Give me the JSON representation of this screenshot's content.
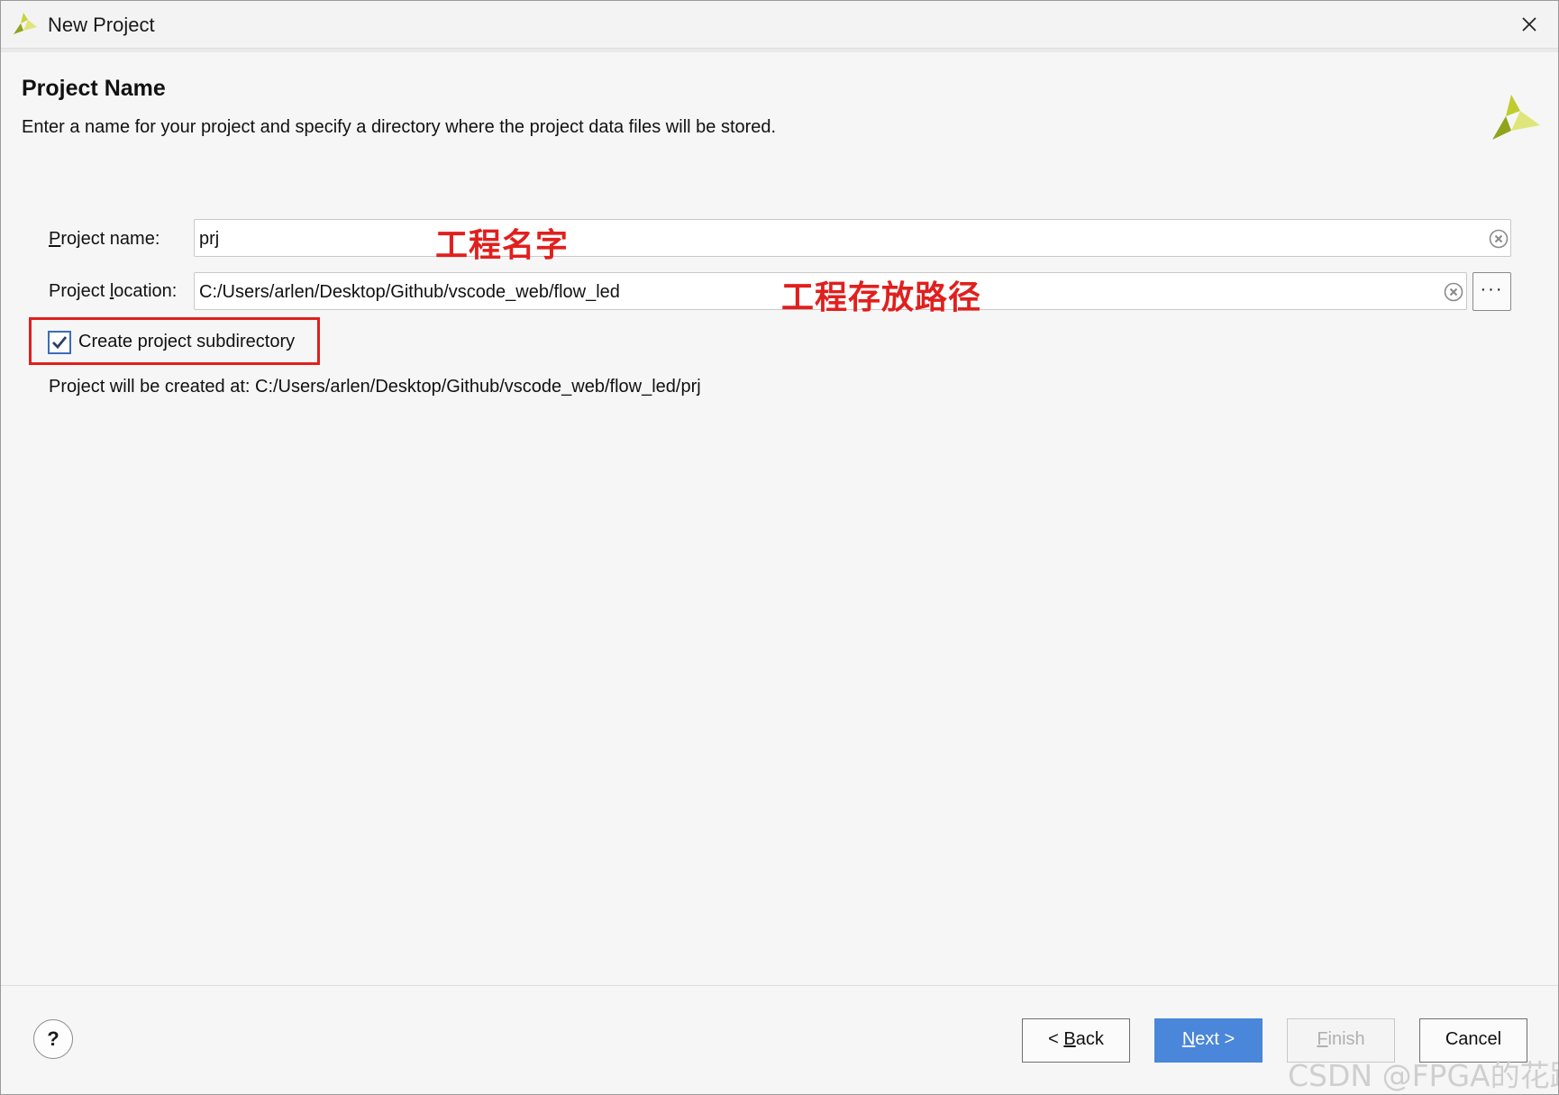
{
  "window": {
    "title": "New Project"
  },
  "header": {
    "title": "Project Name",
    "description": "Enter a name for your project and specify a directory where the project data files will be stored."
  },
  "form": {
    "name_label_mnemonic": "P",
    "name_label_rest": "roject name:",
    "name_value": "prj",
    "name_annotation": "工程名字",
    "location_label_pre": "Project ",
    "location_label_mnemonic": "l",
    "location_label_rest": "ocation:",
    "location_value": "C:/Users/arlen/Desktop/Github/vscode_web/flow_led",
    "location_annotation": "工程存放路径",
    "browse_label": "···",
    "subdir_label": "Create project subdirectory",
    "subdir_checked": true,
    "created_at_text": "Project will be created at: C:/Users/arlen/Desktop/Github/vscode_web/flow_led/prj"
  },
  "footer": {
    "help_label": "?",
    "back_pre": "< ",
    "back_mnemonic": "B",
    "back_rest": "ack",
    "next_mnemonic": "N",
    "next_rest": "ext >",
    "finish_mnemonic": "F",
    "finish_rest": "inish",
    "cancel_label": "Cancel"
  },
  "watermark": "CSDN @FPGA的花路",
  "colors": {
    "accent": "#4a86d9",
    "annotation": "#e0201e",
    "logo_green": "#9bb31b"
  },
  "icons": [
    "vivado-logo-icon",
    "close-icon",
    "clear-icon",
    "more-icon",
    "checkmark-icon",
    "help-icon"
  ]
}
